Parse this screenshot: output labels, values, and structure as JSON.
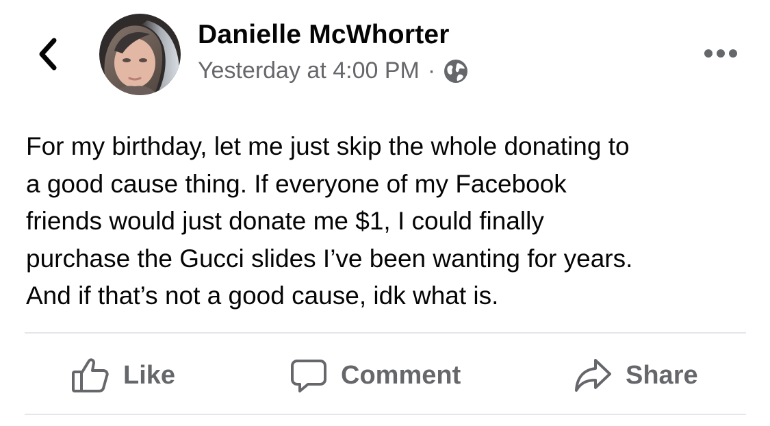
{
  "nav": {
    "back_icon": "chevron-left-icon"
  },
  "post": {
    "author": "Danielle McWhorter",
    "timestamp": "Yesterday at 4:00 PM",
    "separator": "·",
    "privacy_icon": "globe-icon",
    "more_icon": "more-horizontal-icon",
    "body": "For my birthday, let me just skip the whole donating to\na good cause thing. If everyone of my Facebook\nfriends would just donate me $1, I could finally\npurchase the Gucci slides I’ve been wanting for years.\nAnd if that’s not a good cause, idk what is."
  },
  "actions": {
    "like_label": "Like",
    "like_icon": "thumbs-up-icon",
    "comment_label": "Comment",
    "comment_icon": "speech-bubble-icon",
    "share_label": "Share",
    "share_icon": "share-arrow-icon"
  },
  "colors": {
    "text_primary": "#050505",
    "text_secondary": "#65676b",
    "divider": "#e4e6eb",
    "background": "#ffffff"
  }
}
